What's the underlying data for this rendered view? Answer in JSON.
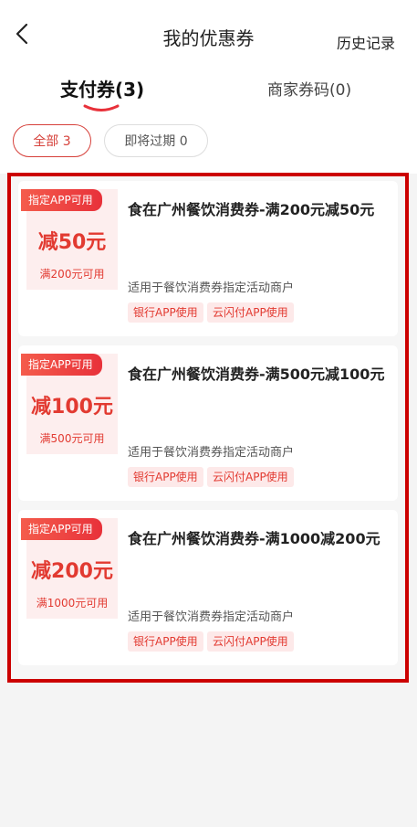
{
  "nav": {
    "back_icon": "chevron-left-icon",
    "title": "我的优惠券",
    "history": "历史记录"
  },
  "tabs": {
    "pay": "支付券(3)",
    "merchant": "商家券码(0)"
  },
  "filters": {
    "all": "全部 3",
    "expiring": "即将过期 0"
  },
  "coupons": [
    {
      "badge": "指定APP可用",
      "amount": "减50元",
      "condition": "满200元可用",
      "title": "食在广州餐饮消费券-满200元减50元",
      "desc": "适用于餐饮消费券指定活动商户",
      "tags": [
        "银行APP使用",
        "云闪付APP使用"
      ]
    },
    {
      "badge": "指定APP可用",
      "amount": "减100元",
      "condition": "满500元可用",
      "title": "食在广州餐饮消费券-满500元减100元",
      "desc": "适用于餐饮消费券指定活动商户",
      "tags": [
        "银行APP使用",
        "云闪付APP使用"
      ]
    },
    {
      "badge": "指定APP可用",
      "amount": "减200元",
      "condition": "满1000元可用",
      "title": "食在广州餐饮消费券-满1000减200元",
      "desc": "适用于餐饮消费券指定活动商户",
      "tags": [
        "银行APP使用",
        "云闪付APP使用"
      ]
    }
  ],
  "colors": {
    "accent": "#e23a31",
    "frame": "#cc0000",
    "badge_bg": "#f45c4c",
    "panel_bg": "#fdeeee"
  }
}
